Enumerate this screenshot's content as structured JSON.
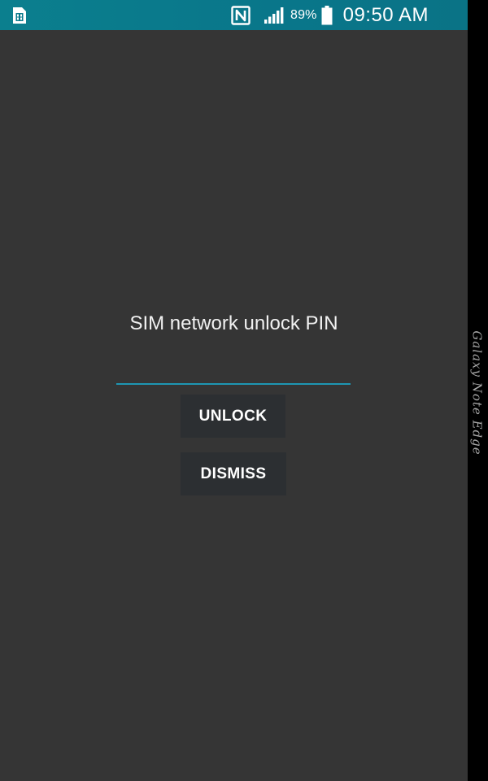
{
  "status_bar": {
    "sim_icon": "sim-card-icon",
    "nfc_icon": "nfc-icon",
    "signal_icon": "signal-strength-icon",
    "battery_percent": "89%",
    "battery_level": 0.89,
    "battery_icon": "battery-icon",
    "time": "09:50 AM",
    "background_color": "#0a7a8c"
  },
  "dialog": {
    "title": "SIM network unlock PIN",
    "pin_value": "",
    "input_underline_color": "#1e96b3",
    "unlock_label": "UNLOCK",
    "dismiss_label": "DISMISS"
  },
  "edge_panel": {
    "label": "Galaxy Note Edge"
  }
}
